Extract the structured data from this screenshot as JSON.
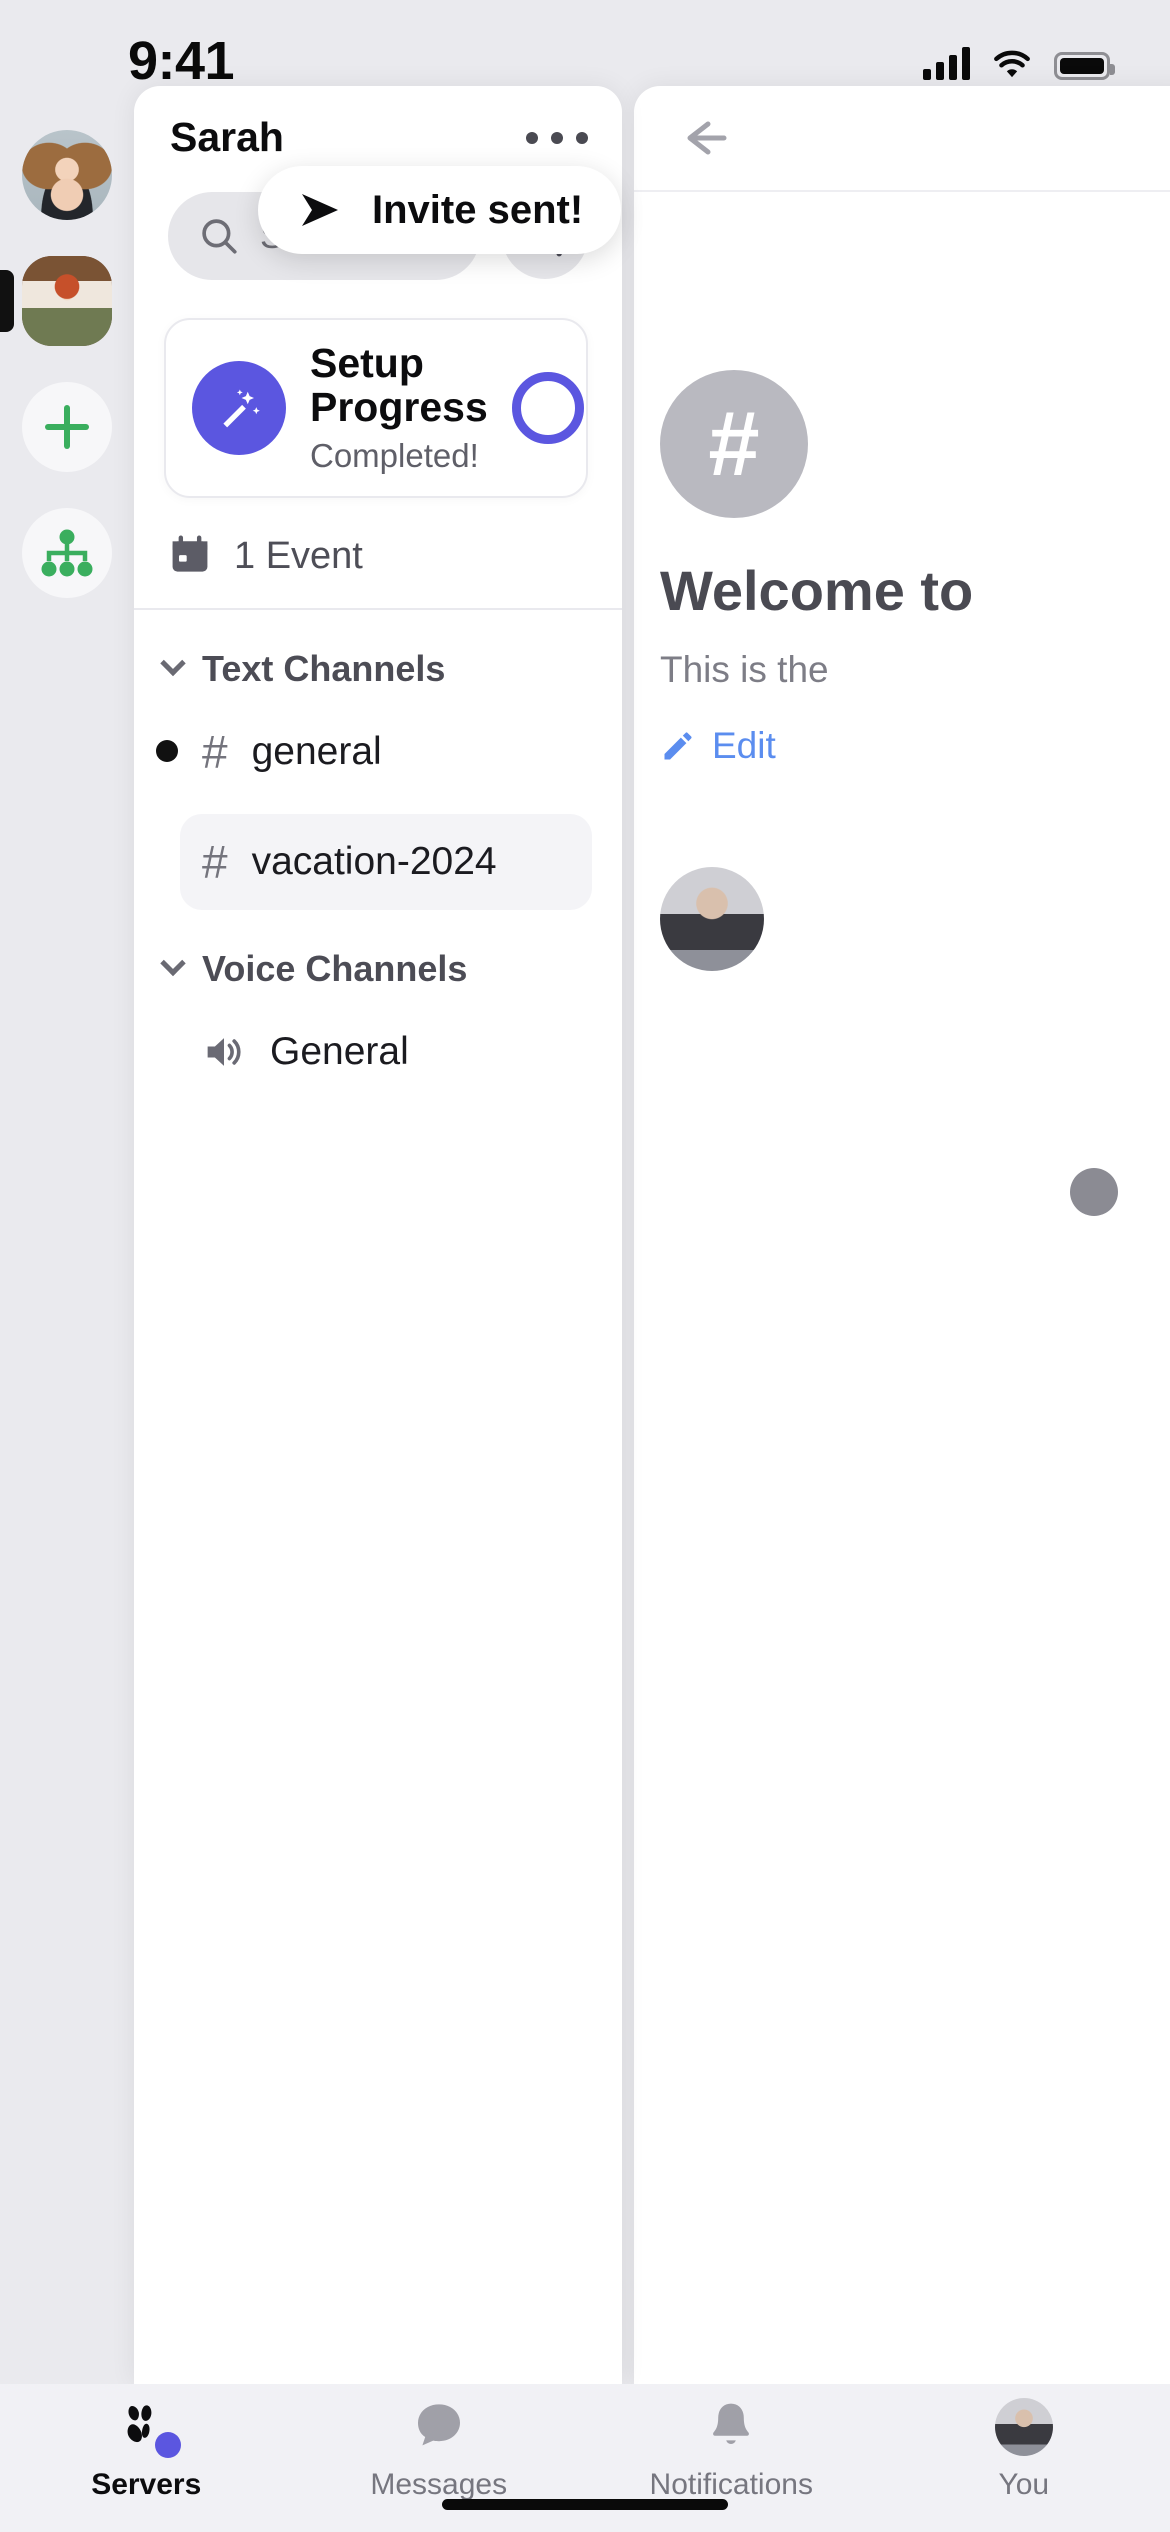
{
  "status_bar": {
    "time": "9:41",
    "signal_icon": "cellular-signal-icon",
    "wifi_icon": "wifi-icon",
    "battery_icon": "battery-icon"
  },
  "server_rail": {
    "items": [
      {
        "name": "user-avatar-server",
        "type": "avatar",
        "selected": false
      },
      {
        "name": "active-server",
        "type": "server",
        "selected": true
      },
      {
        "name": "add-server",
        "type": "button",
        "icon": "plus-icon",
        "selected": false
      },
      {
        "name": "explore-servers",
        "type": "button",
        "icon": "network-tree-icon",
        "selected": false
      }
    ]
  },
  "drawer": {
    "server_name": "Sarah",
    "overflow_icon": "more-horizontal-icon",
    "search": {
      "placeholder": "Search",
      "icon": "search-icon",
      "value": ""
    },
    "invite_button_icon": "add-person-icon",
    "setup_card": {
      "icon": "magic-wand-icon",
      "title": "Setup Progress",
      "subtitle": "Completed!",
      "progress_ring_label": "",
      "chevron_icon": "chevron-right-icon",
      "accent_color": "#5b56e0"
    },
    "events": {
      "icon": "calendar-icon",
      "label": "1 Event"
    },
    "sections": [
      {
        "title": "Text Channels",
        "collapse_icon": "chevron-down-icon",
        "channels": [
          {
            "icon": "hash-icon",
            "name": "general",
            "selected": false,
            "unread": true
          },
          {
            "icon": "hash-icon",
            "name": "vacation-2024",
            "selected": true,
            "unread": false
          }
        ]
      },
      {
        "title": "Voice Channels",
        "collapse_icon": "chevron-down-icon",
        "channels": [
          {
            "icon": "speaker-icon",
            "name": "General",
            "selected": false,
            "unread": false
          }
        ]
      }
    ]
  },
  "toast": {
    "icon": "send-arrow-icon",
    "message": "Invite sent!"
  },
  "content_panel": {
    "back_icon": "arrow-left-icon",
    "channel_icon": "hash-icon",
    "hash_glyph": "#",
    "welcome_title": "Welcome to",
    "welcome_subtitle": "This is the",
    "edit_link": "Edit",
    "edit_icon": "pencil-icon"
  },
  "tab_bar": {
    "tabs": [
      {
        "label": "Servers",
        "icon": "servers-icon",
        "active": true,
        "badge": true
      },
      {
        "label": "Messages",
        "icon": "chat-bubble-icon",
        "active": false,
        "badge": false
      },
      {
        "label": "Notifications",
        "icon": "bell-icon",
        "active": false,
        "badge": false
      },
      {
        "label": "You",
        "icon": "profile-avatar-icon",
        "active": false,
        "badge": false
      }
    ]
  },
  "colors": {
    "accent": "#5b56e0",
    "green": "#3aae5e",
    "background": "#eaeaee",
    "panel": "#ffffff",
    "link": "#5b8def"
  }
}
